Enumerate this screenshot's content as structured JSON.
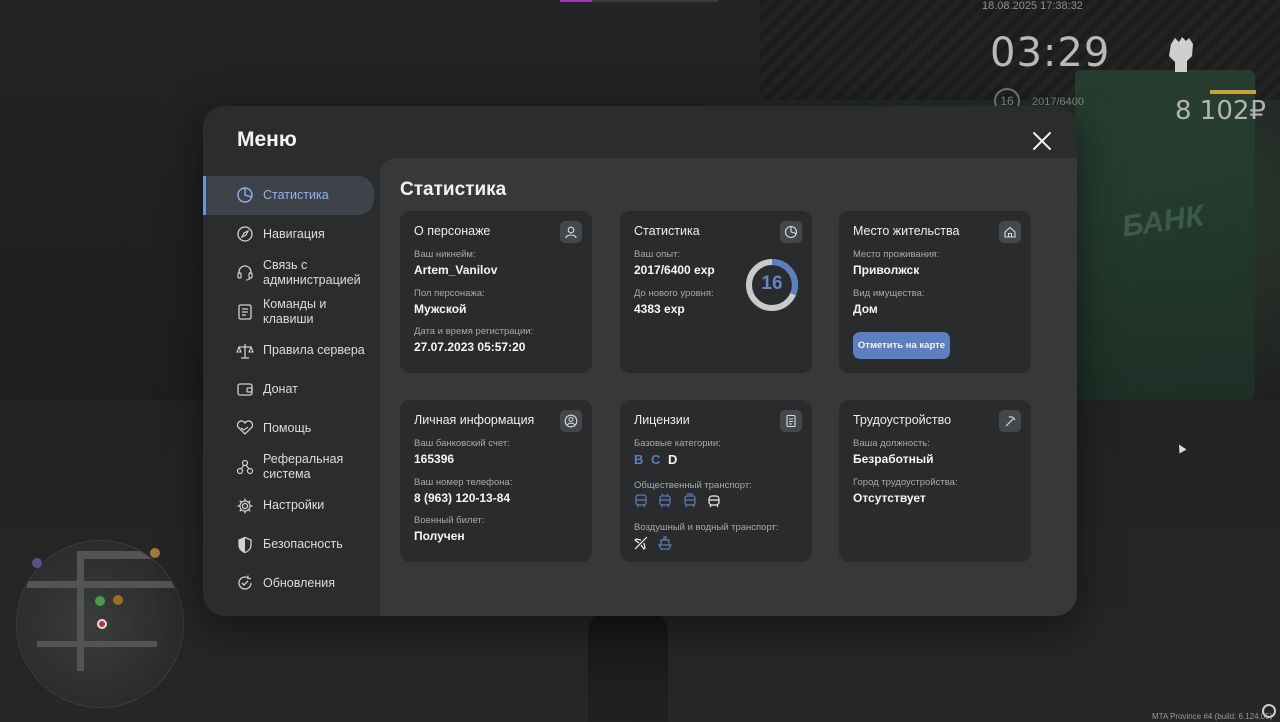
{
  "hud": {
    "datetime": "18.08.2025 17:38:32",
    "clock": "03:29",
    "level": "16",
    "xp": "2017/6400",
    "money": "8 102₽",
    "bank_sign": "БАНК",
    "build": "MTA Province #4 (build: 6.124.05)"
  },
  "menu": {
    "title": "Меню",
    "content_title": "Статистика",
    "sidebar": [
      {
        "label": "Статистика",
        "icon": "stats-pie-icon"
      },
      {
        "label": "Навигация",
        "icon": "compass-icon"
      },
      {
        "label": "Связь с администрацией",
        "icon": "headset-icon"
      },
      {
        "label": "Команды и клавиши",
        "icon": "document-icon"
      },
      {
        "label": "Правила сервера",
        "icon": "scales-icon"
      },
      {
        "label": "Донат",
        "icon": "wallet-icon"
      },
      {
        "label": "Помощь",
        "icon": "heart-hands-icon"
      },
      {
        "label": "Реферальная система",
        "icon": "referral-icon"
      },
      {
        "label": "Настройки",
        "icon": "gear-icon"
      },
      {
        "label": "Безопасность",
        "icon": "shield-icon"
      },
      {
        "label": "Обновления",
        "icon": "update-icon"
      }
    ]
  },
  "cards": {
    "character": {
      "title": "О персонаже",
      "nickname_label": "Ваш никнейм:",
      "nickname": "Artem_Vanilov",
      "gender_label": "Пол персонажа:",
      "gender": "Мужской",
      "reg_label": "Дата и время регистрации:",
      "reg": "27.07.2023 05:57:20"
    },
    "stats": {
      "title": "Статистика",
      "exp_label": "Ваш опыт:",
      "exp": "2017/6400 exp",
      "next_label": "До нового уровня:",
      "next": "4383 exp",
      "level": "16",
      "progress": 0.315
    },
    "residence": {
      "title": "Место жительства",
      "place_label": "Место проживания:",
      "place": "Приволжск",
      "type_label": "Вид имущества:",
      "type": "Дом",
      "button": "Отметить на карте"
    },
    "personal": {
      "title": "Личная информация",
      "bank_label": "Ваш банковский счет:",
      "bank": "165396",
      "phone_label": "Ваш номер телефона:",
      "phone": "8 (963) 120-13-84",
      "military_label": "Военный билет:",
      "military": "Получен"
    },
    "licenses": {
      "title": "Лицензии",
      "base_label": "Базовые категории:",
      "categories": [
        "B",
        "C",
        "D"
      ],
      "public_label": "Общественный транспорт:",
      "air_label": "Воздушный и водный транспорт:"
    },
    "employment": {
      "title": "Трудоустройство",
      "position_label": "Ваша должность:",
      "position": "Безработный",
      "city_label": "Город трудоустройства:",
      "city": "Отсутствует"
    }
  },
  "colors": {
    "accent": "#5b7fbf",
    "accent_light": "#8fb1ec",
    "card_bg": "#2a2b2c",
    "panel_bg": "#373839"
  }
}
